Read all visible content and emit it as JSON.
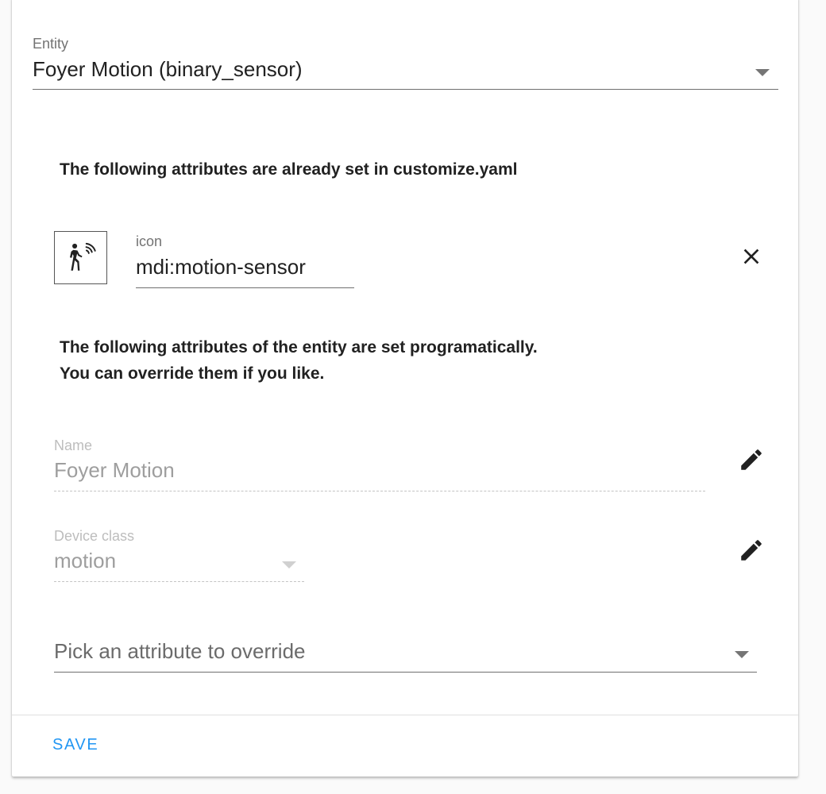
{
  "entity": {
    "label": "Entity",
    "value": "Foyer Motion (binary_sensor)"
  },
  "customize_section": {
    "heading": "The following attributes are already set in customize.yaml",
    "attributes": [
      {
        "label": "icon",
        "value": "mdi:motion-sensor",
        "icon": "motion-sensor-icon"
      }
    ]
  },
  "programmatic_section": {
    "heading_line1": "The following attributes of the entity are set programatically.",
    "heading_line2": "You can override them if you like.",
    "attributes": [
      {
        "label": "Name",
        "value": "Foyer Motion"
      },
      {
        "label": "Device class",
        "value": "motion"
      }
    ]
  },
  "override_picker": {
    "placeholder": "Pick an attribute to override"
  },
  "footer": {
    "save_label": "SAVE"
  },
  "colors": {
    "accent": "#2196f3",
    "text_primary": "#212121",
    "text_disabled": "#9e9e9e"
  }
}
